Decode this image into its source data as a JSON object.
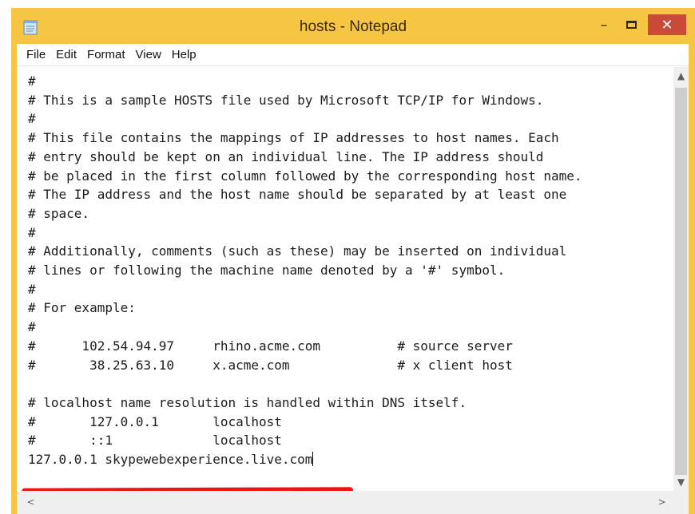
{
  "window": {
    "title": "hosts - Notepad",
    "buttons": {
      "minimize": "–",
      "close": "✕"
    }
  },
  "menu": [
    "File",
    "Edit",
    "Format",
    "View",
    "Help"
  ],
  "editor": {
    "lines": [
      "#",
      "# This is a sample HOSTS file used by Microsoft TCP/IP for Windows.",
      "#",
      "# This file contains the mappings of IP addresses to host names. Each",
      "# entry should be kept on an individual line. The IP address should",
      "# be placed in the first column followed by the corresponding host name.",
      "# The IP address and the host name should be separated by at least one",
      "# space.",
      "#",
      "# Additionally, comments (such as these) may be inserted on individual",
      "# lines or following the machine name denoted by a '#' symbol.",
      "#",
      "# For example:",
      "#",
      "#      102.54.94.97     rhino.acme.com          # source server",
      "#       38.25.63.10     x.acme.com              # x client host",
      "",
      "# localhost name resolution is handled within DNS itself.",
      "#       127.0.0.1       localhost",
      "#       ::1             localhost"
    ],
    "highlighted_line": "127.0.0.1 skypewebexperience.live.com"
  },
  "scrollbars": {
    "up": "▲",
    "down": "▼",
    "left": "<",
    "right": ">"
  }
}
